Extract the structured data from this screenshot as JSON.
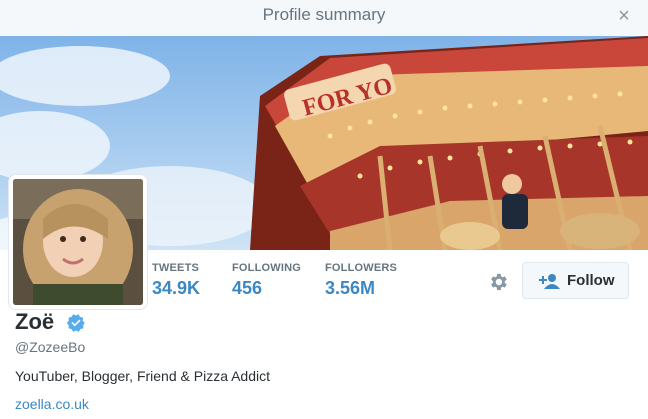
{
  "window": {
    "title": "Profile summary",
    "close_icon": "close-icon"
  },
  "profile": {
    "name": "Zoë",
    "handle": "@ZozeeBo",
    "bio": "YouTuber, Blogger, Friend & Pizza Addict",
    "url": "zoella.co.uk",
    "verified": true
  },
  "stats": [
    {
      "label": "TWEETS",
      "value": "34.9K"
    },
    {
      "label": "FOLLOWING",
      "value": "456"
    },
    {
      "label": "FOLLOWERS",
      "value": "3.56M"
    }
  ],
  "actions": {
    "settings_icon": "gear-icon",
    "follow_label": "Follow",
    "follow_icon": "add-user-icon"
  },
  "banner": {
    "sign_text": "FOR YO"
  },
  "colors": {
    "accent": "#3b88c3",
    "verified": "#55acee",
    "text": "#292f33",
    "muted": "#66757f"
  }
}
